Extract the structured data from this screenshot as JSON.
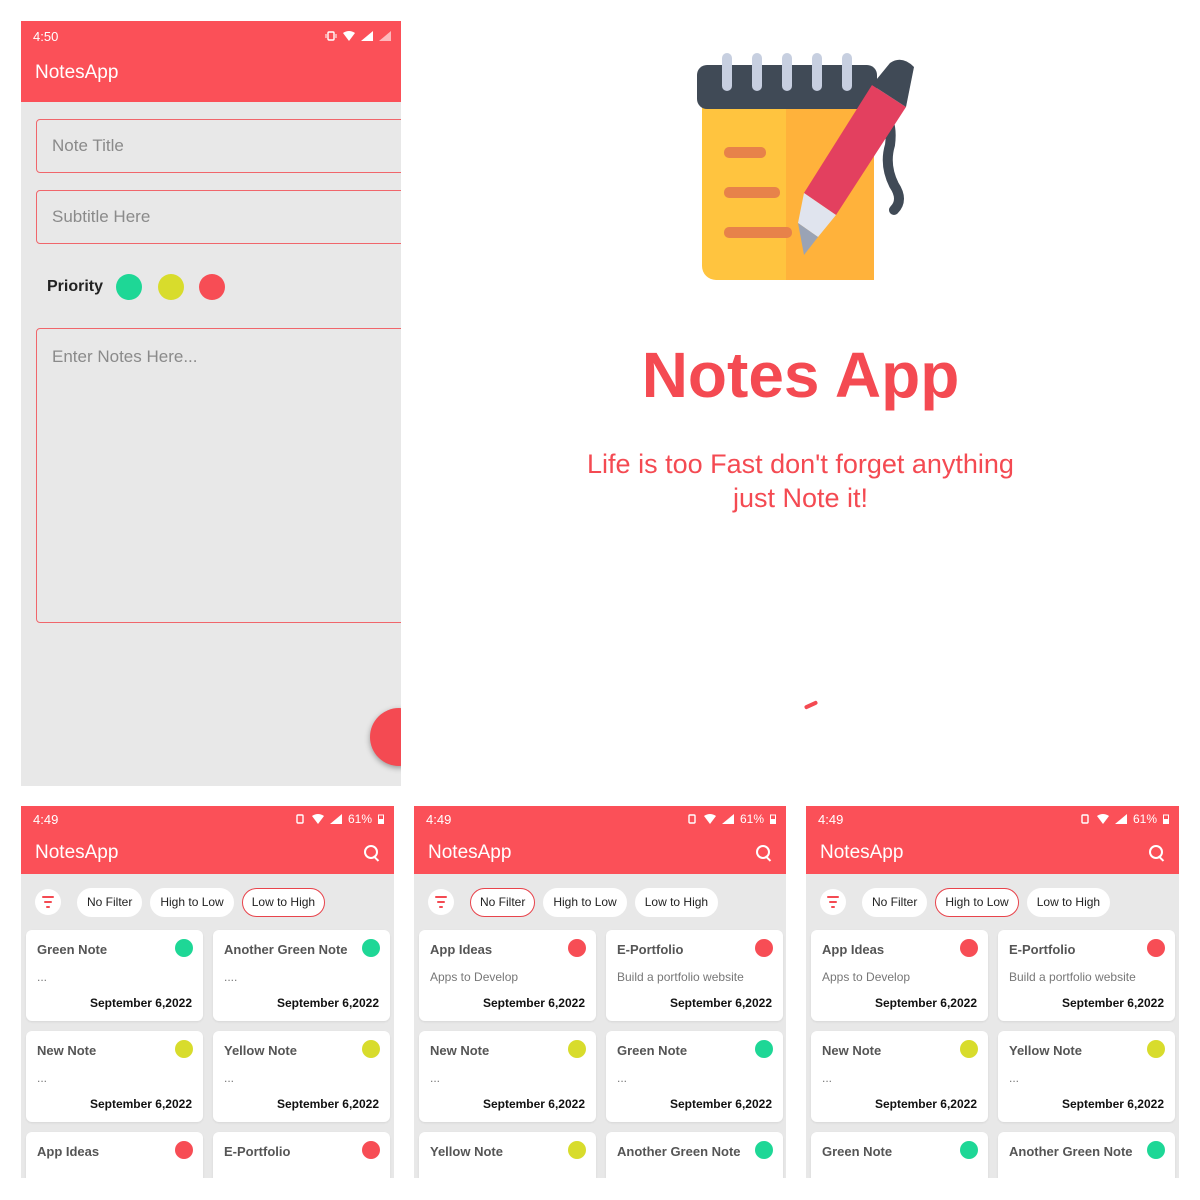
{
  "colors": {
    "brand": "#fb5058",
    "green": "#1ed796",
    "yellow": "#d8dc2c",
    "red": "#f74d55"
  },
  "editor": {
    "status_time": "4:50",
    "app_title": "NotesApp",
    "title_placeholder": "Note Title",
    "subtitle_placeholder": "Subtitle Here",
    "priority_label": "Priority",
    "priority_options": [
      "green",
      "yellow",
      "red"
    ],
    "notes_placeholder": "Enter Notes Here...",
    "fab_icon": "check-icon"
  },
  "splash": {
    "title": "Notes App",
    "tagline_line1": "Life is too Fast don't forget anything",
    "tagline_line2": "just Note it!"
  },
  "lists": [
    {
      "status_time": "4:49",
      "battery": "61%",
      "app_title": "NotesApp",
      "filters": [
        "No Filter",
        "High to Low",
        "Low to High"
      ],
      "active_filter": "Low to High",
      "notes": [
        {
          "title": "Green Note",
          "subtitle": "...",
          "date": "September 6,2022",
          "priority": "green"
        },
        {
          "title": "Another Green Note",
          "subtitle": "....",
          "date": "September 6,2022",
          "priority": "green"
        },
        {
          "title": "New Note",
          "subtitle": "...",
          "date": "September 6,2022",
          "priority": "yellow"
        },
        {
          "title": "Yellow Note",
          "subtitle": "...",
          "date": "September 6,2022",
          "priority": "yellow"
        },
        {
          "title": "App Ideas",
          "subtitle": "",
          "date": "",
          "priority": "red"
        },
        {
          "title": "E-Portfolio",
          "subtitle": "",
          "date": "",
          "priority": "red"
        }
      ]
    },
    {
      "status_time": "4:49",
      "battery": "61%",
      "app_title": "NotesApp",
      "filters": [
        "No Filter",
        "High to Low",
        "Low to High"
      ],
      "active_filter": "No Filter",
      "notes": [
        {
          "title": "App Ideas",
          "subtitle": "Apps to Develop",
          "date": "September 6,2022",
          "priority": "red"
        },
        {
          "title": "E-Portfolio",
          "subtitle": "Build a portfolio website",
          "date": "September 6,2022",
          "priority": "red"
        },
        {
          "title": "New Note",
          "subtitle": "...",
          "date": "September 6,2022",
          "priority": "yellow"
        },
        {
          "title": "Green Note",
          "subtitle": "...",
          "date": "September 6,2022",
          "priority": "green"
        },
        {
          "title": "Yellow Note",
          "subtitle": "",
          "date": "",
          "priority": "yellow"
        },
        {
          "title": "Another Green Note",
          "subtitle": "",
          "date": "",
          "priority": "green"
        }
      ]
    },
    {
      "status_time": "4:49",
      "battery": "61%",
      "app_title": "NotesApp",
      "filters": [
        "No Filter",
        "High to Low",
        "Low to High"
      ],
      "active_filter": "High to Low",
      "notes": [
        {
          "title": "App Ideas",
          "subtitle": "Apps to Develop",
          "date": "September 6,2022",
          "priority": "red"
        },
        {
          "title": "E-Portfolio",
          "subtitle": "Build a portfolio website",
          "date": "September 6,2022",
          "priority": "red"
        },
        {
          "title": "New Note",
          "subtitle": "...",
          "date": "September 6,2022",
          "priority": "yellow"
        },
        {
          "title": "Yellow Note",
          "subtitle": "...",
          "date": "September 6,2022",
          "priority": "yellow"
        },
        {
          "title": "Green Note",
          "subtitle": "",
          "date": "",
          "priority": "green"
        },
        {
          "title": "Another Green Note",
          "subtitle": "",
          "date": "",
          "priority": "green"
        }
      ]
    }
  ]
}
